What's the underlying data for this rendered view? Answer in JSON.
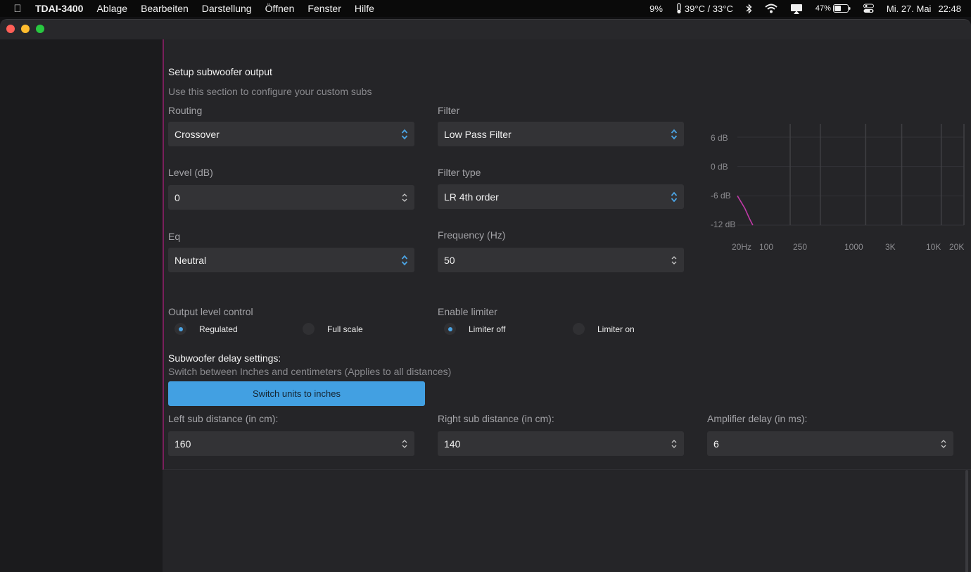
{
  "menubar": {
    "app_name": "TDAI-3400",
    "items": [
      "Ablage",
      "Bearbeiten",
      "Darstellung",
      "Öffnen",
      "Fenster",
      "Hilfe"
    ],
    "cpu": "9%",
    "temperature": "39°C / 33°C",
    "battery": "47%",
    "date": "Mi. 27. Mai",
    "time": "22:48"
  },
  "section": {
    "title": "Setup subwoofer output",
    "subtitle": "Use this section to configure your custom subs"
  },
  "routing": {
    "label": "Routing",
    "value": "Crossover"
  },
  "filter": {
    "label": "Filter",
    "value": "Low Pass Filter"
  },
  "level": {
    "label": "Level (dB)",
    "value": "0"
  },
  "filter_type": {
    "label": "Filter type",
    "value": "LR 4th order"
  },
  "eq": {
    "label": "Eq",
    "value": "Neutral"
  },
  "frequency": {
    "label": "Frequency (Hz)",
    "value": "50"
  },
  "output_level": {
    "label": "Output level control",
    "options": [
      "Regulated",
      "Full scale"
    ],
    "selected": "Regulated"
  },
  "limiter": {
    "label": "Enable limiter",
    "options": [
      "Limiter off",
      "Limiter on"
    ],
    "selected": "Limiter off"
  },
  "delay": {
    "title": "Subwoofer delay settings:",
    "subtitle": "Switch between Inches and centimeters (Applies to all distances)",
    "switch_button": "Switch units to inches",
    "left": {
      "label": "Left sub distance (in cm):",
      "value": "160"
    },
    "right": {
      "label": "Right sub distance (in cm):",
      "value": "140"
    },
    "amp": {
      "label": "Amplifier delay (in ms):",
      "value": "6"
    }
  },
  "colors": {
    "accent": "#42a0e2",
    "curve": "#c03aa8",
    "section_border": "#7a1f5c"
  },
  "chart_data": {
    "type": "line",
    "y_tick_labels": [
      "6 dB",
      "0 dB",
      "-6 dB",
      "-12 dB"
    ],
    "x_tick_labels": [
      "20Hz",
      "100",
      "250",
      "1000",
      "3K",
      "10K",
      "20K"
    ],
    "ylim": [
      -12,
      6
    ],
    "xlim": [
      20,
      20000
    ],
    "x_scale": "log",
    "grid": true,
    "series": [
      {
        "x": [
          20,
          25,
          29,
          32
        ],
        "y": [
          -6,
          -8.5,
          -10.7,
          -12
        ]
      }
    ]
  }
}
